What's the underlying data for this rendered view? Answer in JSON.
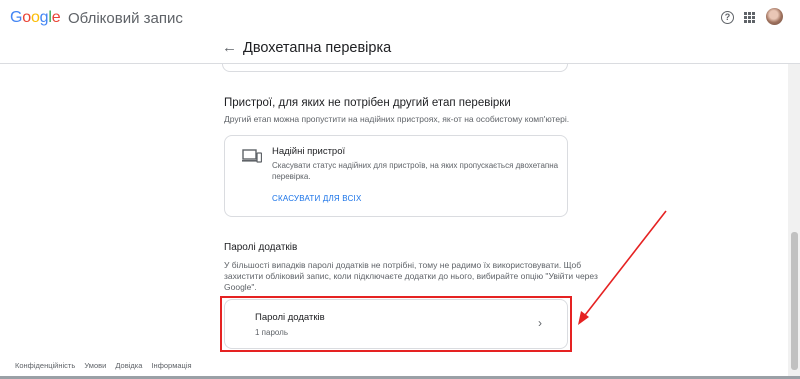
{
  "header": {
    "logo_letters": [
      "G",
      "o",
      "o",
      "g",
      "l",
      "e"
    ],
    "product": "Обліковий запис",
    "page_title": "Двохетапна перевірка",
    "help_symbol": "?",
    "back_symbol": "←"
  },
  "devices_section": {
    "title": "Пристрої, для яких не потрібен другий етап перевірки",
    "description": "Другий етап можна пропустити на надійних пристроях, як-от на особистому комп'ютері.",
    "card": {
      "title": "Надійні пристрої",
      "description_line1": "Скасувати статус надійних для пристроїв, на яких пропускається двохетапна",
      "description_line2": "перевірка.",
      "link": "СКАСУВАТИ ДЛЯ ВСІХ"
    }
  },
  "app_passwords_section": {
    "title": "Паролі додатків",
    "description_line1": "У більшості випадків паролі додатків не потрібні, тому не радимо їх використовувати. Щоб",
    "description_line2": "захистити обліковий запис, коли підключаєте додатки до нього, вибирайте опцію \"Увійти через",
    "description_line3": "Google\".",
    "card": {
      "title": "Паролі додатків",
      "subtitle": "1 пароль",
      "chevron": "›"
    }
  },
  "footer": {
    "links": [
      "Конфіденційність",
      "Умови",
      "Довідка",
      "Інформація"
    ]
  },
  "colors": {
    "accent": "#1a73e8",
    "annotation_red": "#e52222"
  },
  "icons": [
    "help-icon",
    "apps-icon",
    "back-arrow-icon",
    "devices-icon",
    "chevron-right-icon"
  ]
}
